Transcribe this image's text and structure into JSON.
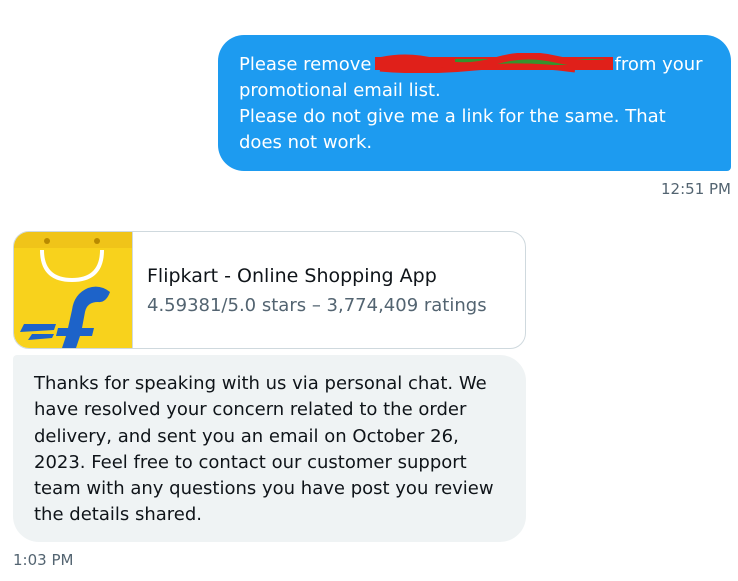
{
  "sent_message": {
    "text_before_redaction": "Please remove",
    "text_after_redaction": "from your promotional email list.",
    "text_line2": "Please do not give me a link for the same. That does not work.",
    "timestamp": "12:51 PM",
    "bubble_color": "#1d9bf0"
  },
  "app_card": {
    "logo_icon": "flipkart-logo-icon",
    "name": "Flipkart - Online Shopping App",
    "rating": "4.59381/5.0 stars – 3,774,409 ratings"
  },
  "received_message": {
    "text": "Thanks for speaking with us via personal chat.  We have resolved your concern related to the order delivery, and sent you an email on October 26, 2023. Feel free to contact our customer support team with any questions you have post you review the details shared.",
    "timestamp": "1:03 PM",
    "bubble_color": "#eff3f4"
  }
}
